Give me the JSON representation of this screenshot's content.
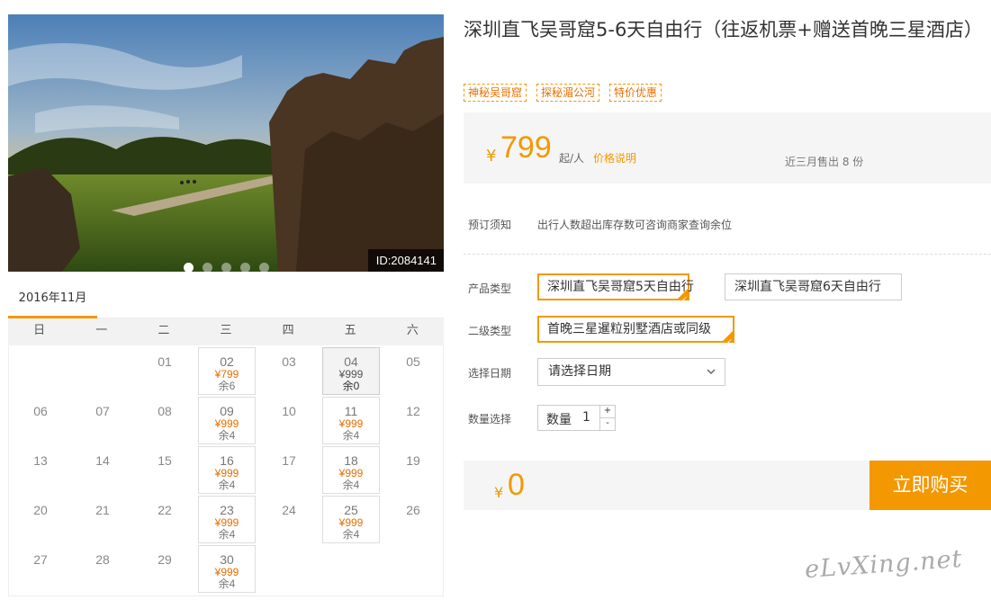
{
  "product": {
    "title": "深圳直飞吴哥窟5-6天自由行（往返机票+赠送首晚三星酒店）",
    "tags": [
      "神秘吴哥窟",
      "探秘湄公河",
      "特价优惠"
    ],
    "id_label": "ID:2084141",
    "carousel_count": 5,
    "carousel_active": 0
  },
  "price": {
    "symbol": "¥",
    "amount": "799",
    "unit": "起/人",
    "note_link": "价格说明",
    "sold": "近三月售出 8 份"
  },
  "notice": {
    "label": "预订须知",
    "text": "出行人数超出库存数可咨询商家查询余位"
  },
  "options": {
    "product_type_label": "产品类型",
    "product_types": [
      {
        "label": "深圳直飞吴哥窟5天自由行",
        "selected": true
      },
      {
        "label": "深圳直飞吴哥窟6天自由行",
        "selected": false
      }
    ],
    "sub_type_label": "二级类型",
    "sub_types": [
      {
        "label": "首晚三星暹粒别墅酒店或同级",
        "selected": true
      }
    ],
    "date_label": "选择日期",
    "date_placeholder": "请选择日期",
    "qty_label": "数量选择",
    "qty_inner_label": "数量",
    "qty_value": "1",
    "qty_plus": "+",
    "qty_minus": "-"
  },
  "total": {
    "symbol": "¥",
    "amount": "0",
    "buy_label": "立即购买"
  },
  "calendar": {
    "month": "2016年11月",
    "weekdays": [
      "日",
      "一",
      "二",
      "三",
      "四",
      "五",
      "六"
    ],
    "weeks": [
      [
        null,
        null,
        {
          "d": "01"
        },
        {
          "d": "02",
          "p": "¥799",
          "r": "余6"
        },
        {
          "d": "03"
        },
        {
          "d": "04",
          "p": "¥999",
          "r": "余0",
          "selected": true
        },
        {
          "d": "05"
        }
      ],
      [
        {
          "d": "06"
        },
        {
          "d": "07"
        },
        {
          "d": "08"
        },
        {
          "d": "09",
          "p": "¥999",
          "r": "余4"
        },
        {
          "d": "10"
        },
        {
          "d": "11",
          "p": "¥999",
          "r": "余4"
        },
        {
          "d": "12"
        }
      ],
      [
        {
          "d": "13"
        },
        {
          "d": "14"
        },
        {
          "d": "15"
        },
        {
          "d": "16",
          "p": "¥999",
          "r": "余4"
        },
        {
          "d": "17"
        },
        {
          "d": "18",
          "p": "¥999",
          "r": "余4"
        },
        {
          "d": "19"
        }
      ],
      [
        {
          "d": "20"
        },
        {
          "d": "21"
        },
        {
          "d": "22"
        },
        {
          "d": "23",
          "p": "¥999",
          "r": "余4"
        },
        {
          "d": "24"
        },
        {
          "d": "25",
          "p": "¥999",
          "r": "余4"
        },
        {
          "d": "26"
        }
      ],
      [
        {
          "d": "27"
        },
        {
          "d": "28"
        },
        {
          "d": "29"
        },
        {
          "d": "30",
          "p": "¥999",
          "r": "余4"
        },
        null,
        null,
        null
      ]
    ]
  },
  "watermark": "eLvXing.net",
  "icons": [
    "chevron-down-icon",
    "check-corner-icon"
  ],
  "colors": {
    "accent": "#f39800",
    "price": "#e76f00",
    "panel": "#f5f5f5"
  }
}
